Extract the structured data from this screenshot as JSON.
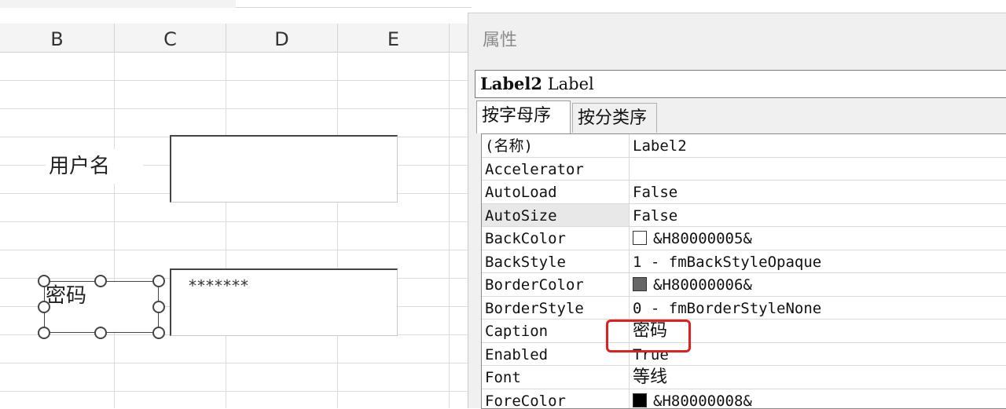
{
  "sheet": {
    "columns": [
      "B",
      "C",
      "D",
      "E"
    ],
    "labels": {
      "username": "用户名",
      "password": "密码"
    },
    "password_value": "*******"
  },
  "properties": {
    "title": "属性",
    "object": {
      "name": "Label2",
      "type": "Label"
    },
    "tabs": [
      "按字母序",
      "按分类序"
    ],
    "rows": [
      {
        "key": "(名称)",
        "value": "Label2"
      },
      {
        "key": "Accelerator",
        "value": ""
      },
      {
        "key": "AutoLoad",
        "value": "False"
      },
      {
        "key": "AutoSize",
        "value": "False"
      },
      {
        "key": "BackColor",
        "value": "&H80000005&",
        "swatch": "#ffffff"
      },
      {
        "key": "BackStyle",
        "value": "1 - fmBackStyleOpaque"
      },
      {
        "key": "BorderColor",
        "value": "&H80000006&",
        "swatch": "#666666"
      },
      {
        "key": "BorderStyle",
        "value": "0 - fmBorderStyleNone"
      },
      {
        "key": "Caption",
        "value": "密码"
      },
      {
        "key": "Enabled",
        "value": "True"
      },
      {
        "key": "Font",
        "value": "等线"
      },
      {
        "key": "ForeColor",
        "value": "&H80000008&",
        "swatch": "#000000"
      }
    ]
  },
  "colors": {
    "highlight": "#e02020",
    "selected_row": "#e8e8e8"
  }
}
